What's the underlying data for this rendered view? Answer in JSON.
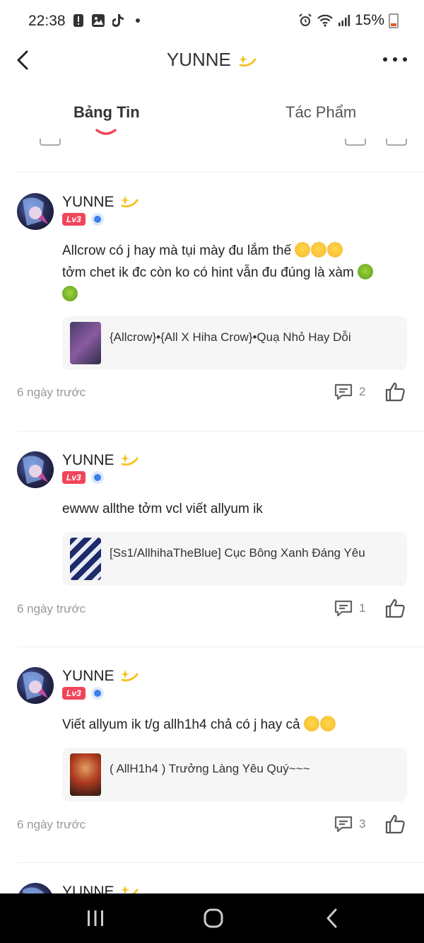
{
  "status_bar": {
    "time": "22:38",
    "battery": "15%"
  },
  "header": {
    "title": "YUNNE"
  },
  "tabs": [
    {
      "label": "Bảng Tin"
    },
    {
      "label": "Tác Phẩm"
    }
  ],
  "posts": [
    {
      "author": "YUNNE",
      "level": "Lv3",
      "text_line1": "Allcrow có j hay mà tụi mày đu lắm thế",
      "text_line2": "tởm chet ik đc còn ko có hint vẫn đu đúng là xàm",
      "story_title": "{Allcrow}•{All X Hiha Crow}•Quạ Nhỏ Hay Dỗi",
      "time_ago": "6 ngày trước",
      "comments": "2"
    },
    {
      "author": "YUNNE",
      "level": "Lv3",
      "text_line1": "ewww allthe tởm vcl viết allyum ik",
      "story_title": "[Ss1/AllhihaTheBlue] Cục Bông Xanh Đáng Yêu",
      "time_ago": "6 ngày trước",
      "comments": "1"
    },
    {
      "author": "YUNNE",
      "level": "Lv3",
      "text_line1": "Viết allyum ik t/g allh1h4 chả có j hay cả",
      "story_title": "( AllH1h4 ) Trưởng Làng Yêu Quý~~~",
      "time_ago": "6 ngày trước",
      "comments": "3"
    },
    {
      "author": "YUNNE"
    }
  ],
  "colors": {
    "accent": "#f0465a",
    "verify": "#3d7ee8",
    "nav_bg": "#000000"
  }
}
